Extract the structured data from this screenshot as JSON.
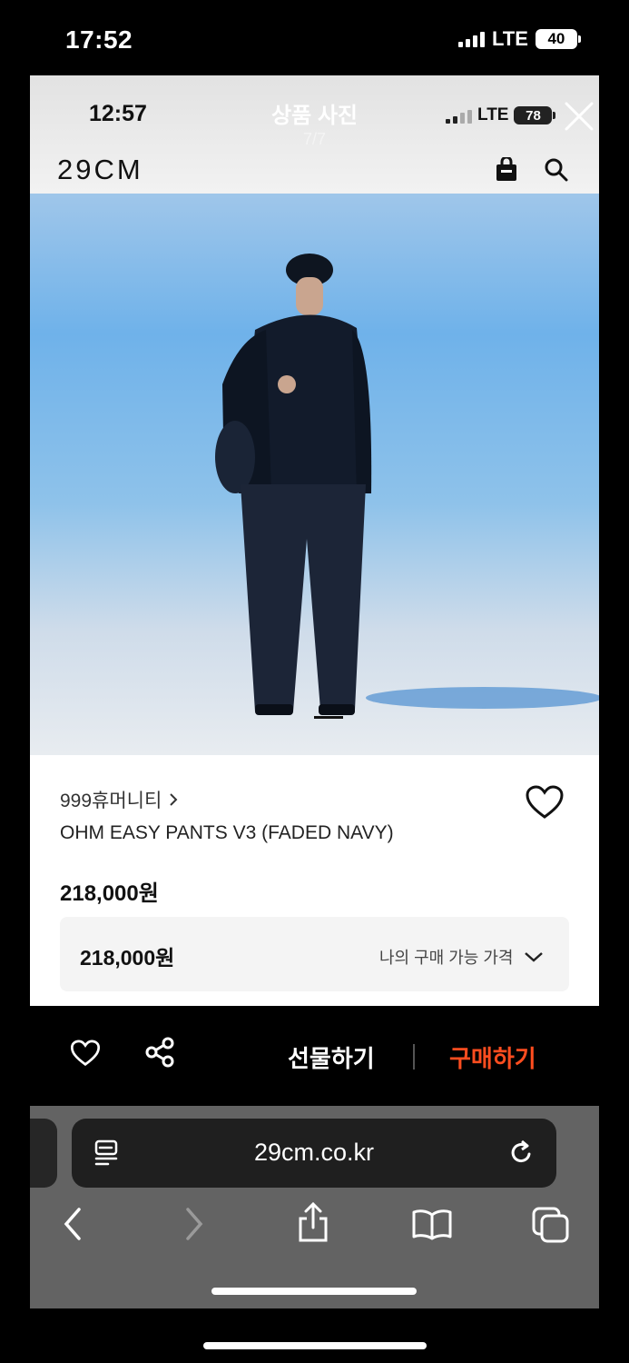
{
  "outer_status": {
    "time": "17:52",
    "network": "LTE",
    "battery": "40"
  },
  "viewer": {
    "title": "상품 사진",
    "counter": "7/7"
  },
  "inner_status": {
    "time": "12:57",
    "network": "LTE",
    "battery": "78"
  },
  "header": {
    "logo": "29CM"
  },
  "product": {
    "brand": "999휴머니티",
    "name": "OHM EASY PANTS V3 (FADED NAVY)",
    "price": "218,000원",
    "my_price": "218,000원",
    "my_price_label": "나의 구매 가능 가격"
  },
  "actions": {
    "gift": "선물하기",
    "buy": "구매하기",
    "buy_color": "#ff4d1f"
  },
  "browser": {
    "url": "29cm.co.kr"
  },
  "icons": [
    "close-icon",
    "shopping-bag-icon",
    "search-icon",
    "heart-icon",
    "share-icon",
    "chevron-down-icon",
    "chevron-right-icon",
    "reader-icon",
    "reload-icon",
    "back-icon",
    "forward-icon",
    "share-sheet-icon",
    "bookmarks-icon",
    "tabs-icon"
  ]
}
